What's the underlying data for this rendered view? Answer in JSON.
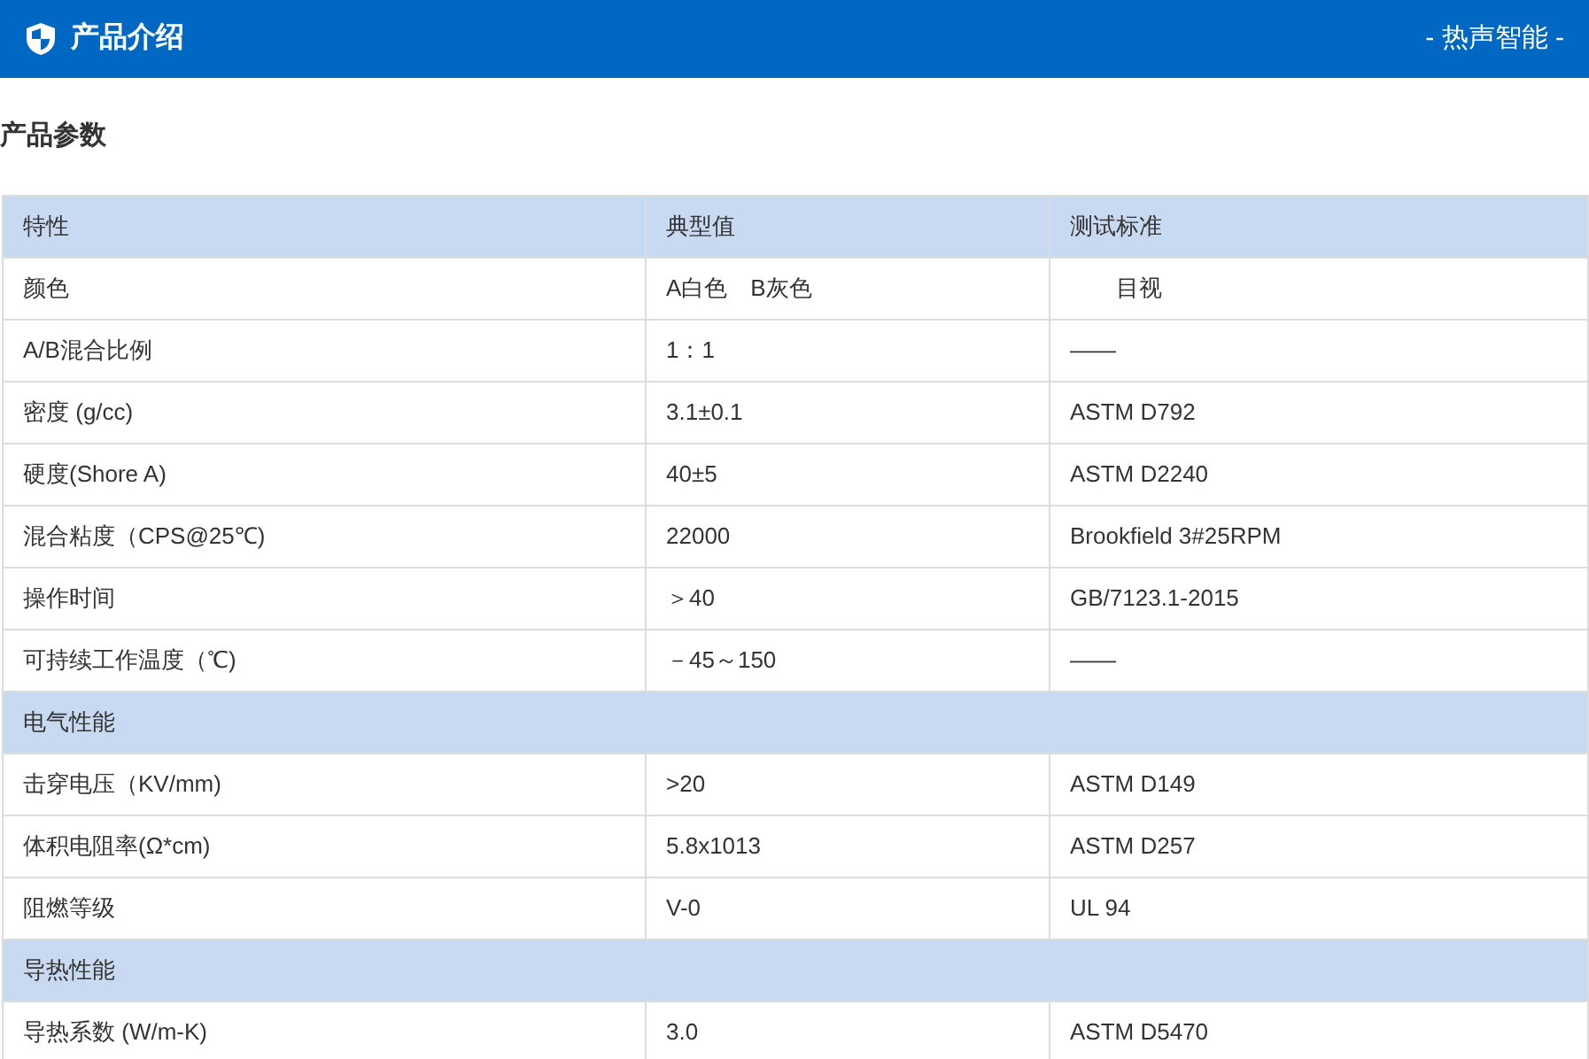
{
  "header": {
    "title": "产品介绍",
    "tagline": "- 热声智能 -"
  },
  "section_title": "产品参数",
  "table": {
    "rows": [
      {
        "kind": "header",
        "cells": [
          "特性",
          "典型值",
          "测试标准"
        ]
      },
      {
        "kind": "data",
        "cells": [
          "颜色",
          "A白色　B灰色",
          "　　目视"
        ]
      },
      {
        "kind": "data",
        "cells": [
          "A/B混合比例",
          "1：1",
          "——"
        ]
      },
      {
        "kind": "data",
        "cells": [
          "密度 (g/cc)",
          "3.1±0.1",
          "ASTM D792"
        ]
      },
      {
        "kind": "data",
        "cells": [
          "硬度(Shore A)",
          "40±5",
          "ASTM D2240"
        ]
      },
      {
        "kind": "data",
        "cells": [
          "混合粘度（CPS@25℃)",
          "22000",
          "Brookfield 3#25RPM"
        ]
      },
      {
        "kind": "data",
        "cells": [
          "操作时间",
          "＞40",
          "GB/7123.1-2015"
        ]
      },
      {
        "kind": "data",
        "cells": [
          "可持续工作温度（℃)",
          "－45～150",
          "——"
        ]
      },
      {
        "kind": "section",
        "cells": [
          "电气性能"
        ]
      },
      {
        "kind": "data",
        "cells": [
          "击穿电压（KV/mm)",
          ">20",
          "ASTM D149"
        ]
      },
      {
        "kind": "data",
        "cells": [
          "体积电阻率(Ω*cm)",
          "5.8x1013",
          "ASTM D257"
        ]
      },
      {
        "kind": "data",
        "cells": [
          "阻燃等级",
          "V-0",
          "UL 94"
        ]
      },
      {
        "kind": "section",
        "cells": [
          "导热性能"
        ]
      },
      {
        "kind": "data",
        "cells": [
          "导热系数 (W/m-K)",
          "3.0",
          "ASTM D5470"
        ]
      }
    ]
  }
}
